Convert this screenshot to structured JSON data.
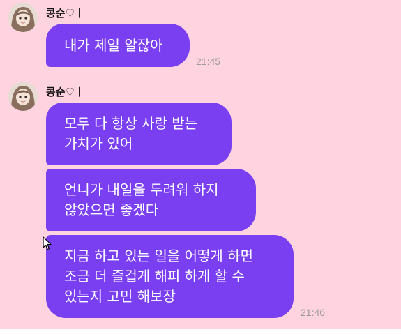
{
  "colors": {
    "background": "#ffd3e0",
    "bubble": "#7b3ff2",
    "bubble_text": "#ffffff",
    "time_text": "#9a9a9a",
    "sender_text": "#111111"
  },
  "messages": [
    {
      "sender": "콩순♡ㅣ",
      "avatar_icon": "profile-avatar",
      "bubbles": [
        {
          "lines": [
            "내가 제일 알잖아"
          ],
          "time": "21:45"
        }
      ]
    },
    {
      "sender": "콩순♡ㅣ",
      "avatar_icon": "profile-avatar",
      "bubbles": [
        {
          "lines": [
            "모두 다 항상 사랑 받는",
            "가치가 있어"
          ]
        },
        {
          "lines": [
            "언니가 내일을 두려워 하지",
            "않았으면 좋겠다"
          ]
        },
        {
          "lines": [
            "지금 하고 있는 일을 어떻게 하면",
            "조금 더 즐겁게 해피 하게 할 수",
            "있는지 고민 해보장"
          ],
          "time": "21:46"
        }
      ]
    }
  ],
  "cursor_icon": "mouse-pointer"
}
